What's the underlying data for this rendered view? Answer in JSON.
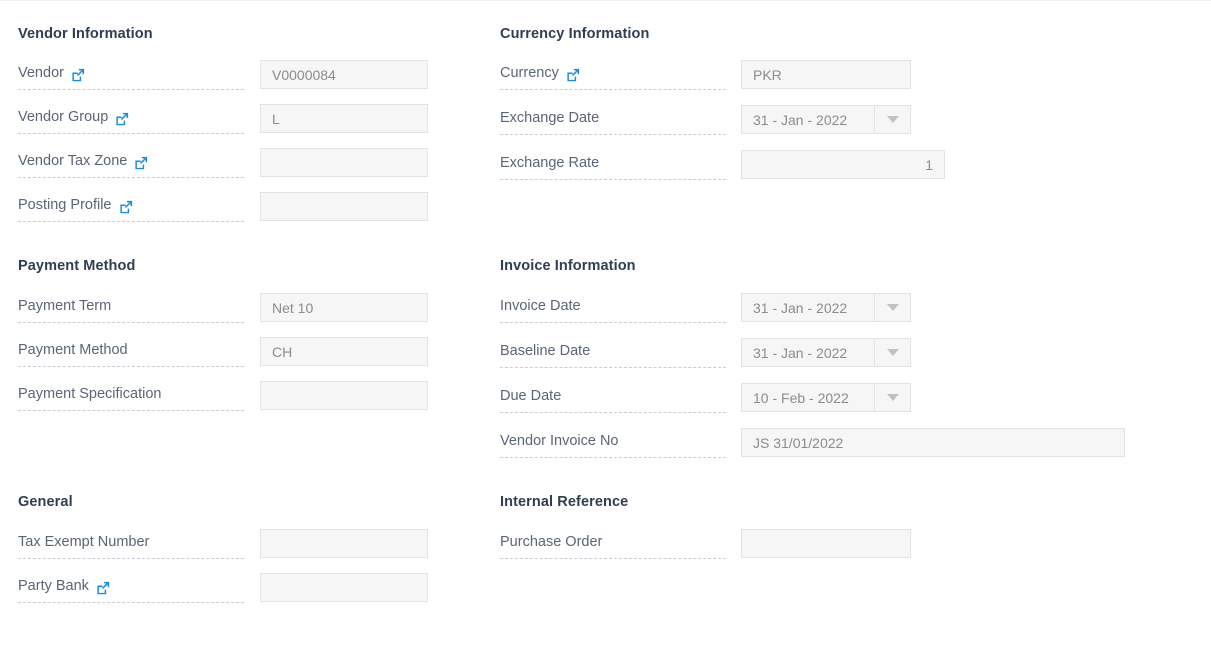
{
  "form": {
    "sections": [
      {
        "id": "vendor-information",
        "title": "Vendor Information",
        "fields": [
          {
            "id": "vendor",
            "label": "Vendor",
            "value": "V0000084",
            "icon": "external-link-icon",
            "control": "lookup"
          },
          {
            "id": "vendor-group",
            "label": "Vendor Group",
            "value": "L",
            "icon": "external-link-icon",
            "control": "lookup"
          },
          {
            "id": "vendor-tax-zone",
            "label": "Vendor Tax Zone",
            "value": "",
            "icon": "external-link-icon",
            "control": "lookup"
          },
          {
            "id": "posting-profile",
            "label": "Posting Profile",
            "value": "",
            "icon": "external-link-icon",
            "control": "lookup"
          }
        ]
      },
      {
        "id": "currency-information",
        "title": "Currency Information",
        "fields": [
          {
            "id": "currency",
            "label": "Currency",
            "value": "PKR",
            "icon": "external-link-icon",
            "control": "lookup"
          },
          {
            "id": "exchange-date",
            "label": "Exchange Date",
            "value": "31 - Jan - 2022",
            "icon": null,
            "control": "datepicker"
          },
          {
            "id": "exchange-rate",
            "label": "Exchange Rate",
            "value": "1",
            "icon": null,
            "control": "number"
          }
        ]
      },
      {
        "id": "payment-method",
        "title": "Payment Method",
        "fields": [
          {
            "id": "payment-term",
            "label": "Payment Term",
            "value": "Net 10",
            "icon": null,
            "control": "text"
          },
          {
            "id": "payment-method",
            "label": "Payment Method",
            "value": "CH",
            "icon": null,
            "control": "text"
          },
          {
            "id": "payment-specification",
            "label": "Payment Specification",
            "value": "",
            "icon": null,
            "control": "text"
          }
        ]
      },
      {
        "id": "invoice-information",
        "title": "Invoice Information",
        "fields": [
          {
            "id": "invoice-date",
            "label": "Invoice Date",
            "value": "31 - Jan - 2022",
            "icon": null,
            "control": "datepicker"
          },
          {
            "id": "baseline-date",
            "label": "Baseline Date",
            "value": "31 - Jan - 2022",
            "icon": null,
            "control": "datepicker"
          },
          {
            "id": "due-date",
            "label": "Due Date",
            "value": "10 - Feb - 2022",
            "icon": null,
            "control": "datepicker"
          },
          {
            "id": "vendor-invoice-no",
            "label": "Vendor Invoice No",
            "value": "JS 31/01/2022",
            "icon": null,
            "control": "text"
          }
        ]
      },
      {
        "id": "general",
        "title": "General",
        "fields": [
          {
            "id": "tax-exempt-number",
            "label": "Tax Exempt Number",
            "value": "",
            "icon": null,
            "control": "text"
          },
          {
            "id": "party-bank",
            "label": "Party Bank",
            "value": "",
            "icon": "external-link-icon",
            "control": "lookup"
          }
        ]
      },
      {
        "id": "internal-reference",
        "title": "Internal Reference",
        "fields": [
          {
            "id": "purchase-order",
            "label": "Purchase Order",
            "value": "",
            "icon": null,
            "control": "text"
          }
        ]
      }
    ]
  },
  "colors": {
    "heading": "#2f3e52",
    "label": "#5a6576",
    "value": "#8c8c8c",
    "icon_accent": "#1a8fd4",
    "input_fill": "#f6f6f6",
    "input_border": "#e2e3e5",
    "label_rule": "#c9ccd1",
    "caret": "#c2c2c2"
  }
}
